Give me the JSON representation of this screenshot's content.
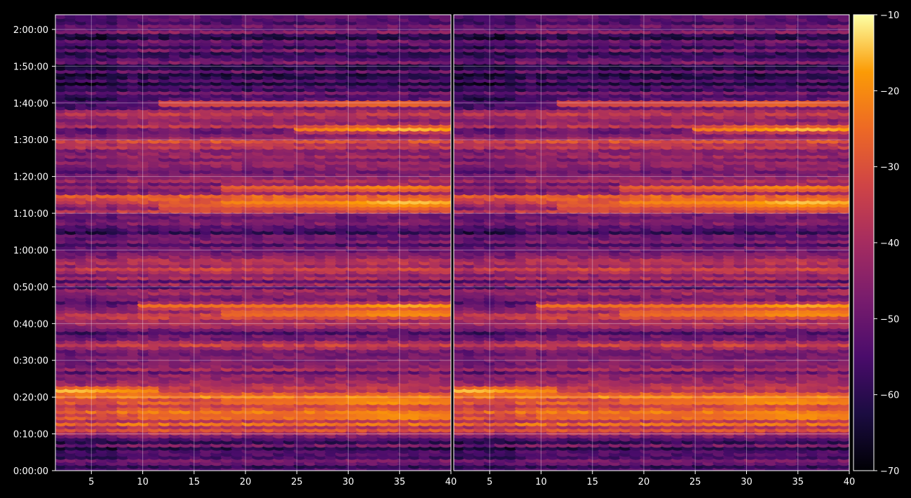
{
  "chart_data": {
    "type": "heatmap",
    "title": "",
    "colormap": "inferno",
    "background": "#000000",
    "panels": [
      {
        "name": "left",
        "x_range": [
          1.5,
          40
        ],
        "x_ticks": [
          5,
          10,
          15,
          20,
          25,
          30,
          35,
          40
        ],
        "y_axis_visible": true
      },
      {
        "name": "right",
        "x_range": [
          1.5,
          40
        ],
        "x_ticks": [
          5,
          10,
          15,
          20,
          25,
          30,
          35,
          40
        ],
        "y_axis_visible": false
      }
    ],
    "y_axis": {
      "unit": "seconds",
      "range": [
        0,
        7440
      ],
      "ticks": [
        0,
        600,
        1200,
        1800,
        2400,
        3000,
        3600,
        4200,
        4800,
        5400,
        6000,
        6600,
        7200
      ],
      "tick_labels": [
        "0:00:00",
        "0:10:00",
        "0:20:00",
        "0:30:00",
        "0:40:00",
        "0:50:00",
        "1:00:00",
        "1:10:00",
        "1:20:00",
        "1:30:00",
        "1:40:00",
        "1:50:00",
        "2:00:00"
      ]
    },
    "colorbar": {
      "range": [
        -70,
        -10
      ],
      "ticks": [
        -70,
        -60,
        -50,
        -40,
        -30,
        -20,
        -10
      ],
      "tick_labels": [
        "−70",
        "−60",
        "−50",
        "−40",
        "−30",
        "−20",
        "−10"
      ]
    },
    "grid": true,
    "time_profile_db": [
      [
        0,
        -57
      ],
      [
        150,
        -52
      ],
      [
        330,
        -55
      ],
      [
        540,
        -50
      ],
      [
        630,
        -40
      ],
      [
        720,
        -33
      ],
      [
        900,
        -30
      ],
      [
        1080,
        -27
      ],
      [
        1200,
        -28
      ],
      [
        1320,
        -31
      ],
      [
        1500,
        -40
      ],
      [
        1680,
        -45
      ],
      [
        1800,
        -52
      ],
      [
        2040,
        -40
      ],
      [
        2220,
        -52
      ],
      [
        2340,
        -44
      ],
      [
        2400,
        -38
      ],
      [
        2520,
        -30
      ],
      [
        2700,
        -52
      ],
      [
        2880,
        -44
      ],
      [
        3060,
        -48
      ],
      [
        3300,
        -38
      ],
      [
        3420,
        -42
      ],
      [
        3600,
        -48
      ],
      [
        3840,
        -52
      ],
      [
        4080,
        -46
      ],
      [
        4260,
        -40
      ],
      [
        4380,
        -30
      ],
      [
        4500,
        -33
      ],
      [
        4560,
        -40
      ],
      [
        4740,
        -46
      ],
      [
        4920,
        -48
      ],
      [
        5100,
        -44
      ],
      [
        5280,
        -40
      ],
      [
        5400,
        -36
      ],
      [
        5520,
        -46
      ],
      [
        5700,
        -38
      ],
      [
        5880,
        -44
      ],
      [
        6060,
        -52
      ],
      [
        6300,
        -55
      ],
      [
        6600,
        -54
      ],
      [
        7080,
        -54
      ],
      [
        7200,
        -50
      ],
      [
        7440,
        -56
      ]
    ],
    "bright_bands": [
      {
        "t": 4380,
        "x_from": 18,
        "x_to": 40,
        "peak_db": -12,
        "peak_x": 36
      },
      {
        "t": 4320,
        "x_from": 12,
        "x_to": 40,
        "peak_db": -17,
        "peak_x": 35
      },
      {
        "t": 2580,
        "x_from": 18,
        "x_to": 40,
        "peak_db": -14,
        "peak_x": 36
      },
      {
        "t": 2700,
        "x_from": 10,
        "x_to": 40,
        "peak_db": -15,
        "peak_x": 36
      },
      {
        "t": 1320,
        "x_from": 1.5,
        "x_to": 12,
        "peak_db": -13,
        "peak_x": 3
      },
      {
        "t": 1140,
        "x_from": 18,
        "x_to": 40,
        "peak_db": -16,
        "peak_x": 34
      },
      {
        "t": 900,
        "x_from": 10,
        "x_to": 40,
        "peak_db": -17,
        "peak_x": 36
      },
      {
        "t": 6000,
        "x_from": 12,
        "x_to": 40,
        "peak_db": -17,
        "peak_x": 34
      },
      {
        "t": 5580,
        "x_from": 25,
        "x_to": 40,
        "peak_db": -15,
        "peak_x": 36
      },
      {
        "t": 4620,
        "x_from": 18,
        "x_to": 40,
        "peak_db": -16,
        "peak_x": 34
      }
    ]
  }
}
